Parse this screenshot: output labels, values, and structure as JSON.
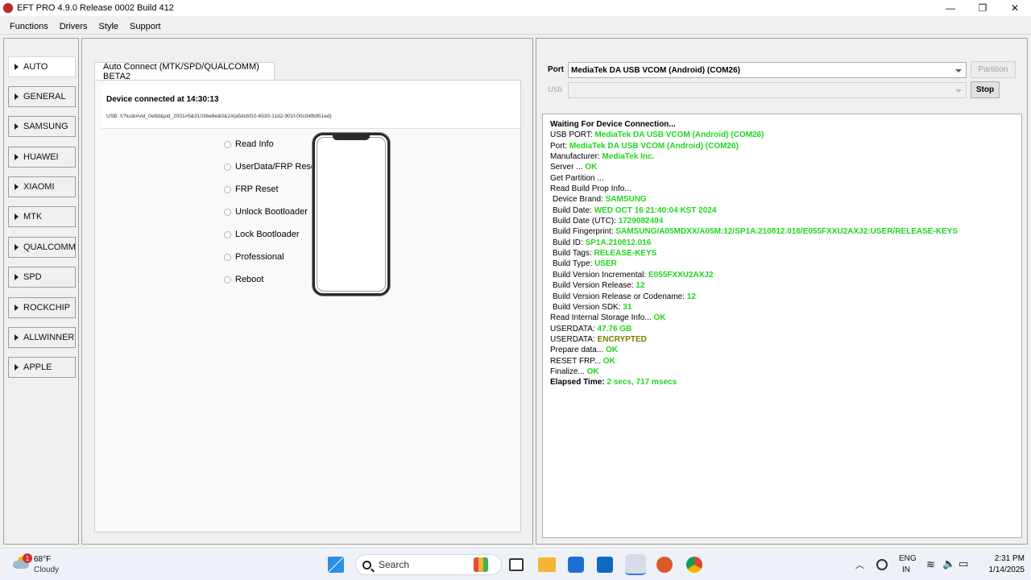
{
  "window": {
    "title": "EFT PRO 4.9.0 Release 0002 Build 412",
    "controls": {
      "minimize": "—",
      "maximize": "❐",
      "close": "✕"
    }
  },
  "menu": [
    "Functions",
    "Drivers",
    "Style",
    "Support"
  ],
  "sidebar": {
    "items": [
      "AUTO",
      "GENERAL",
      "SAMSUNG",
      "HUAWEI",
      "XIAOMI",
      "MTK",
      "QUALCOMM",
      "SPD",
      "ROCKCHIP",
      "ALLWINNER",
      "APPLE"
    ],
    "active": "AUTO"
  },
  "tab": {
    "label": "Auto Connect (MTK/SPD/QUALCOMM) BETA2",
    "device_status": "Device connected at 14:30:13",
    "usb_path": "USB: \\\\?\\usb#vid_0e8d&pid_2001#5&31036e8e&0&2#{a5dcbf10-6530-11d2-901f-00c04fb951ed}",
    "options": [
      "Read Info",
      "UserData/FRP Reset",
      "FRP Reset",
      "Unlock Bootloader",
      "Lock Bootloader",
      "Professional",
      "Reboot"
    ]
  },
  "port": {
    "port_label": "Port",
    "port_value": "MediaTek DA USB VCOM (Android) (COM26)",
    "usb_label": "Usb",
    "usb_value": "",
    "partition_button": "Partition",
    "stop_button": "Stop"
  },
  "log": [
    {
      "k": "Waiting For Device Connection...",
      "v": "",
      "bold": true
    },
    {
      "k": "USB PORT: ",
      "v": "MediaTek DA USB VCOM (Android) (COM26)"
    },
    {
      "k": "Port: ",
      "v": "MediaTek DA USB VCOM (Android) (COM26)"
    },
    {
      "k": "Manufacturer: ",
      "v": "MediaTek Inc."
    },
    {
      "k": "Server ... ",
      "v": "OK"
    },
    {
      "k": "Get Partition ...",
      "v": ""
    },
    {
      "k": "Read Build Prop Info...",
      "v": ""
    },
    {
      "k": " Device Brand: ",
      "v": "SAMSUNG",
      "indent": true
    },
    {
      "k": " Build Date: ",
      "v": "WED OCT 16 21:40:04 KST 2024",
      "indent": true
    },
    {
      "k": " Build Date (UTC): ",
      "v": "1729082404",
      "indent": true
    },
    {
      "k": " Build Fingerprint: ",
      "v": "SAMSUNG/A05MDXX/A05M:12/SP1A.210812.016/E055FXXU2AXJ2:USER/RELEASE-KEYS",
      "indent": true
    },
    {
      "k": " Build ID: ",
      "v": "SP1A.210812.016",
      "indent": true
    },
    {
      "k": " Build Tags: ",
      "v": "RELEASE-KEYS",
      "indent": true
    },
    {
      "k": " Build Type: ",
      "v": "USER",
      "indent": true
    },
    {
      "k": " Build Version Incremental: ",
      "v": "E055FXXU2AXJ2",
      "indent": true
    },
    {
      "k": " Build Version Release: ",
      "v": "12",
      "indent": true
    },
    {
      "k": " Build Version Release or Codename: ",
      "v": "12",
      "indent": true
    },
    {
      "k": " Build Version SDK: ",
      "v": "31",
      "indent": true
    },
    {
      "k": "Read Internal Storage Info... ",
      "v": "OK"
    },
    {
      "k": "USERDATA: ",
      "v": "47.76 GB"
    },
    {
      "k": "USERDATA: ",
      "v": "ENCRYPTED",
      "olive": true
    },
    {
      "k": "Prepare data... ",
      "v": "OK"
    },
    {
      "k": "RESET FRP... ",
      "v": "OK"
    },
    {
      "k": "Finalize... ",
      "v": "OK"
    },
    {
      "k": "Elapsed Time: ",
      "v": "2 secs, 717 msecs",
      "bold": true
    }
  ],
  "colors": {
    "ok_green": "#1fd81f",
    "olive": "#7b7b00"
  },
  "taskbar": {
    "weather_temp": "68°F",
    "weather_cond": "Cloudy",
    "weather_badge": "1",
    "search_placeholder": "Search",
    "lang_top": "ENG",
    "lang_bottom": "IN",
    "time": "2:31 PM",
    "date": "1/14/2025"
  }
}
